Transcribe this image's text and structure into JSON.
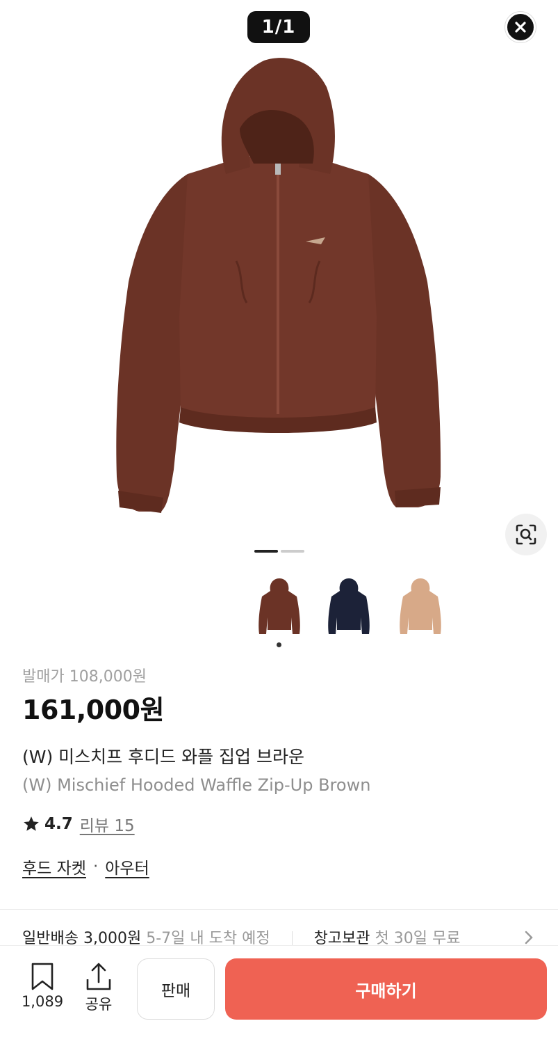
{
  "gallery": {
    "counter": "1/1",
    "current_index": 1,
    "total_slides": 2,
    "close_icon": "close-icon",
    "lens_icon": "image-search-icon"
  },
  "swatches": [
    {
      "color_name": "brown",
      "color": "#6b3326"
    },
    {
      "color_name": "navy",
      "color": "#1c2238"
    },
    {
      "color_name": "beige",
      "color": "#d7a988"
    }
  ],
  "product": {
    "original_price": "발매가 108,000원",
    "price": "161,000원",
    "name_ko": "(W) 미스치프 후디드 와플 집업 브라운",
    "name_en": "(W) Mischief Hooded Waffle Zip-Up Brown",
    "rating": "4.7",
    "review_link": "리뷰 15",
    "categories": [
      "후드 자켓",
      "아우터"
    ],
    "category_separator": "·"
  },
  "shipping": {
    "label": "일반배송",
    "fee": "3,000원",
    "eta": "5-7일 내 도착 예정",
    "storage_label": "창고보관",
    "storage_offer": "첫 30일 무료"
  },
  "bottom_bar": {
    "bookmark_count": "1,089",
    "share_label": "공유",
    "sell_label": "판매",
    "buy_label": "구매하기"
  },
  "colors": {
    "accent": "#ef6253",
    "product_brown": "#6b3326"
  }
}
